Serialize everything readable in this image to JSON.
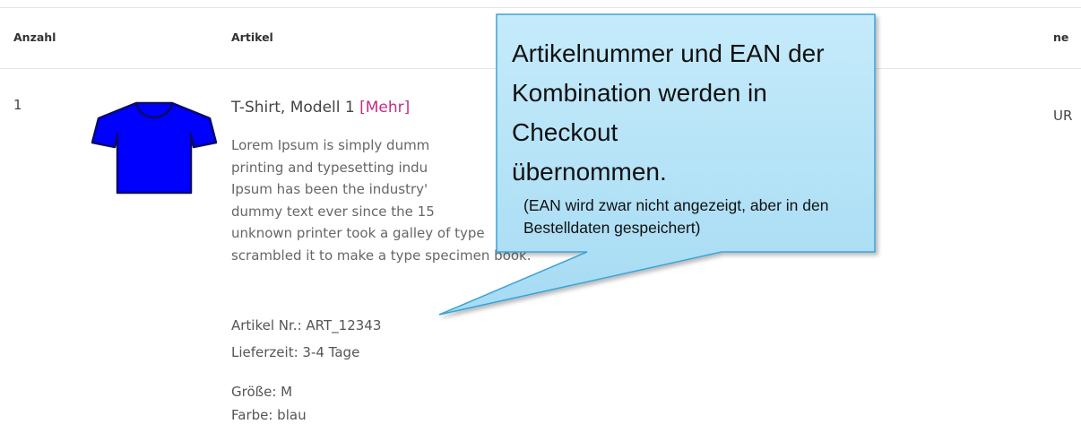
{
  "table": {
    "headers": {
      "qty": "Anzahl",
      "item": "Artikel",
      "price": "ne"
    }
  },
  "row": {
    "qty": "1",
    "image_icon": "tshirt-icon",
    "image_color": "#0000ff",
    "title": "T-Shirt, Modell 1",
    "more_link": "[Mehr]",
    "description_lines": [
      "Lorem Ipsum is simply dumm",
      "printing and typesetting indu",
      "Ipsum has been the industry'",
      "dummy text ever since the 15",
      "unknown printer took a galley of type",
      "scrambled it to make a type specimen book."
    ],
    "article_no": "Artikel Nr.: ART_12343",
    "delivery": "Lieferzeit: 3-4 Tage",
    "size": "Größe: M",
    "color": "Farbe: blau",
    "price_fragment": "UR"
  },
  "callout": {
    "main_lines": [
      "Artikelnummer und EAN der",
      "Kombination werden in Checkout",
      "übernommen."
    ],
    "note_lines": [
      "(EAN wird zwar nicht angezeigt, aber in den",
      "Bestelldaten gespeichert)"
    ],
    "fill": "#b3e2f6",
    "border": "#3aa3d8"
  }
}
